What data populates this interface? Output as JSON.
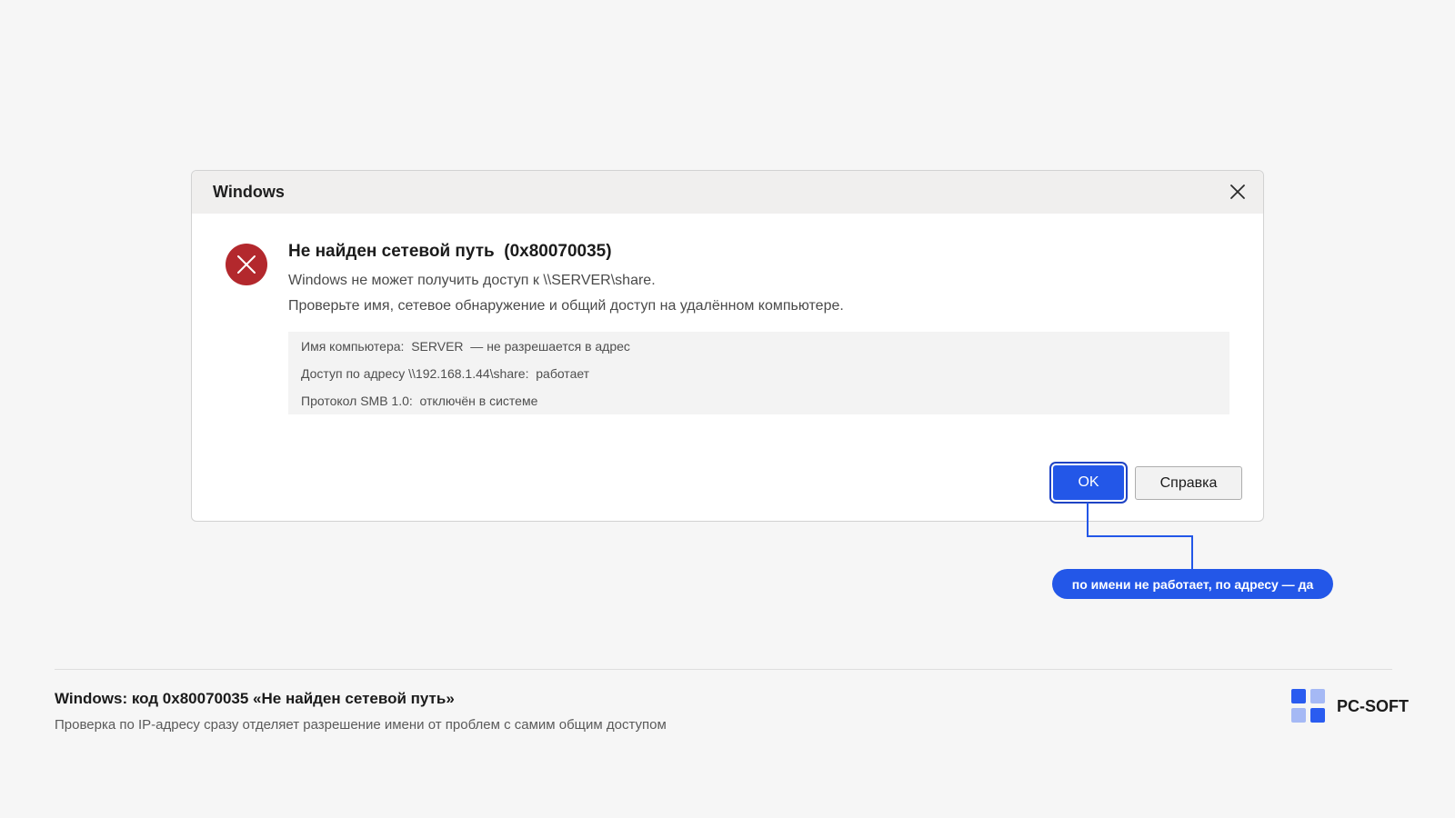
{
  "dialog": {
    "title": "Windows",
    "heading": "Не найден сетевой путь  (0x80070035)",
    "line1": "Windows не может получить доступ к \\\\SERVER\\share.",
    "line2": "Проверьте имя, сетевое обнаружение и общий доступ на удалённом компьютере.",
    "details": [
      "Имя компьютера:  SERVER  — не разрешается в адрес",
      "Доступ по адресу \\\\192.168.1.44\\share:  работает",
      "Протокол SMB 1.0:  отключён в системе"
    ],
    "ok_label": "OK",
    "help_label": "Справка",
    "icons": {
      "close": "close-icon",
      "error": "error-icon"
    }
  },
  "callout": {
    "text": "по имени не работает, по адресу — да"
  },
  "footer": {
    "title": "Windows: код 0x80070035 «Не найден сетевой путь»",
    "subtitle": "Проверка по IP-адресу сразу отделяет разрешение имени от проблем с самим общим доступом",
    "brand": "PC-SOFT"
  },
  "colors": {
    "accent": "#2357e8",
    "error_red": "#b3282d",
    "background": "#f6f6f6",
    "titlebar": "#f0efee"
  }
}
